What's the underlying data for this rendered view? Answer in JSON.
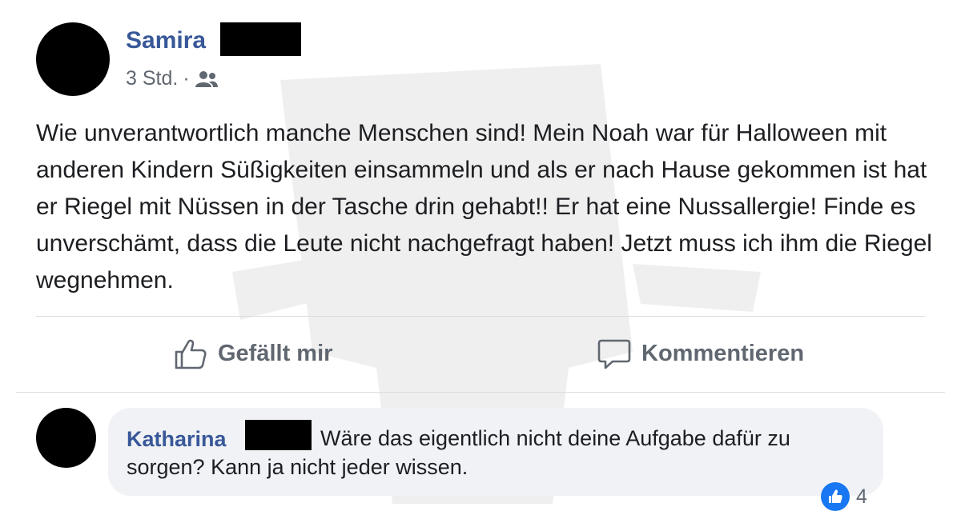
{
  "post": {
    "author": "Samira",
    "timestamp": "3 Std.",
    "separator": "·",
    "audience_icon": "friends-icon",
    "text": "Wie unverantwortlich manche Menschen sind! Mein Noah war für Halloween mit anderen Kindern Süßigkeiten einsammeln und als er nach Hause gekommen ist hat er Riegel mit Nüssen in der Tasche drin gehabt!! Er hat eine Nussallergie! Finde es unverschämt, dass die Leute nicht nachgefragt haben! Jetzt muss ich ihm die Riegel wegnehmen."
  },
  "actions": {
    "like_label": "Gefällt mir",
    "like_icon": "thumbs-up-icon",
    "comment_label": "Kommentieren",
    "comment_icon": "speech-bubble-icon"
  },
  "comment": {
    "author": "Katharina",
    "text": "Wäre das eigentlich nicht deine Aufgabe dafür zu sorgen? Kann ja nicht jeder wissen.",
    "reaction_icon": "like-reaction-icon",
    "reaction_count": "4"
  },
  "colors": {
    "name_blue": "#385898",
    "text": "#1c1e21",
    "muted": "#606770",
    "bubble_bg": "#f0f2f5",
    "like_blue": "#1877f2"
  }
}
